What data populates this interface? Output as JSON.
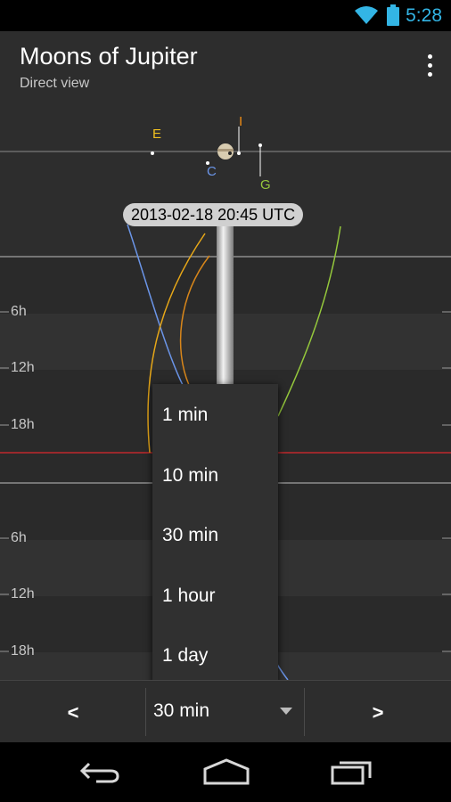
{
  "status": {
    "time": "5:28",
    "time_color": "#33b5e5"
  },
  "app": {
    "title": "Moons of Jupiter",
    "subtitle": "Direct view"
  },
  "view": {
    "moons": [
      {
        "label": "E",
        "color": "#f0c020"
      },
      {
        "label": "I",
        "color": "#f08c14"
      },
      {
        "label": "C",
        "color": "#6b95e8"
      },
      {
        "label": "G",
        "color": "#95c83c"
      }
    ],
    "datetime": "2013-02-18   20:45 UTC",
    "timeline_ticks": [
      "6h",
      "12h",
      "18h",
      "6h",
      "12h",
      "18h"
    ],
    "now_line_color": "#c0282c"
  },
  "step_menu": {
    "options": [
      "1 min",
      "10 min",
      "30 min",
      "1 hour",
      "1 day"
    ]
  },
  "bottom": {
    "prev": "<",
    "next": ">",
    "step_value": "30 min"
  },
  "icons": {
    "overflow": "more-vert-icon",
    "wifi": "wifi-icon",
    "battery": "battery-icon",
    "back": "back-icon",
    "home": "home-icon",
    "recents": "recents-icon",
    "spinner": "dropdown-arrow-icon"
  }
}
